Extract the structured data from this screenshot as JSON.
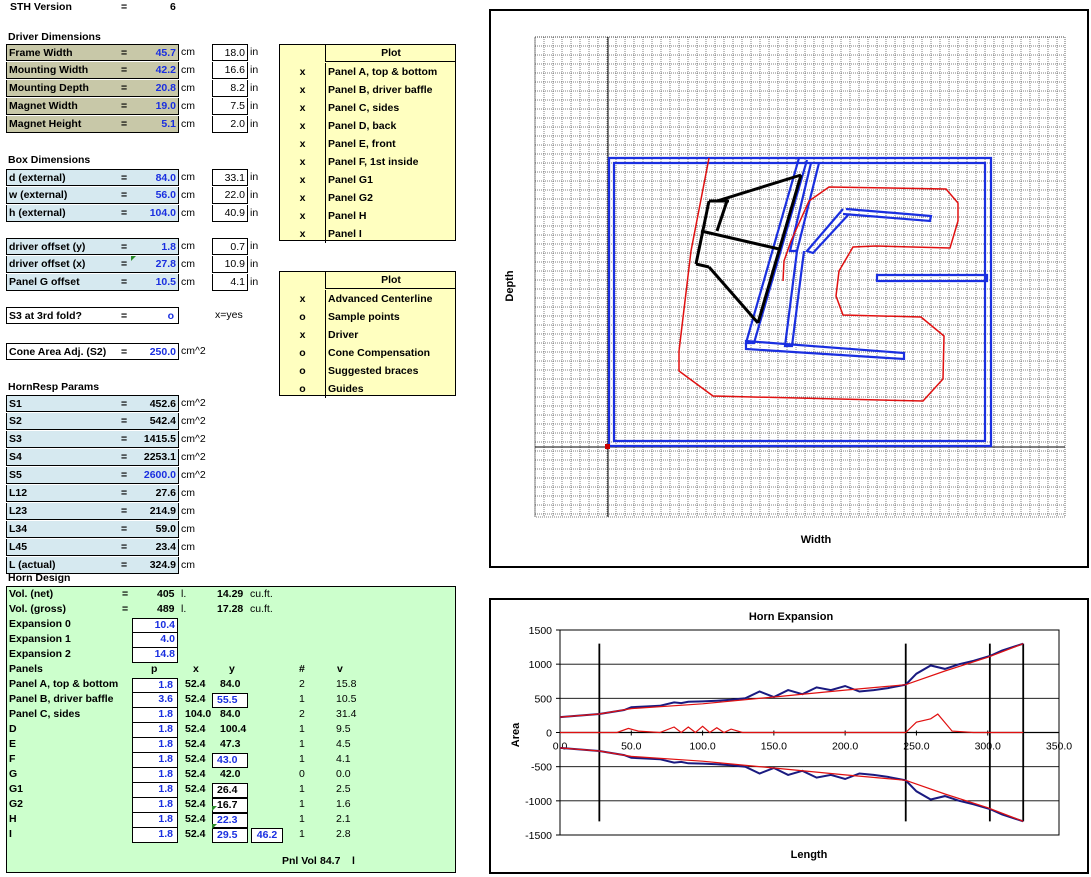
{
  "sth": {
    "label": "STH Version",
    "eq": "=",
    "value": "6"
  },
  "driver": {
    "title": "Driver Dimensions",
    "rows": [
      {
        "label": "Frame Width",
        "eq": "=",
        "cm": "45.7",
        "unit": "cm",
        "in": "18.0",
        "unit2": "in"
      },
      {
        "label": "Mounting Width",
        "eq": "=",
        "cm": "42.2",
        "unit": "cm",
        "in": "16.6",
        "unit2": "in"
      },
      {
        "label": "Mounting Depth",
        "eq": "=",
        "cm": "20.8",
        "unit": "cm",
        "in": "8.2",
        "unit2": "in"
      },
      {
        "label": "Magnet Width",
        "eq": "=",
        "cm": "19.0",
        "unit": "cm",
        "in": "7.5",
        "unit2": "in"
      },
      {
        "label": "Magnet Height",
        "eq": "=",
        "cm": "5.1",
        "unit": "cm",
        "in": "2.0",
        "unit2": "in"
      }
    ]
  },
  "box": {
    "title": "Box Dimensions",
    "rows": [
      {
        "label": "d (external)",
        "eq": "=",
        "cm": "84.0",
        "unit": "cm",
        "in": "33.1",
        "unit2": "in"
      },
      {
        "label": "w (external)",
        "eq": "=",
        "cm": "56.0",
        "unit": "cm",
        "in": "22.0",
        "unit2": "in"
      },
      {
        "label": "h (external)",
        "eq": "=",
        "cm": "104.0",
        "unit": "cm",
        "in": "40.9",
        "unit2": "in"
      }
    ]
  },
  "offsets": [
    {
      "label": "driver offset (y)",
      "eq": "=",
      "cm": "1.8",
      "unit": "cm",
      "in": "0.7",
      "unit2": "in"
    },
    {
      "label": "driver offset (x)",
      "eq": "=",
      "cm": "27.8",
      "unit": "cm",
      "in": "10.9",
      "unit2": "in"
    },
    {
      "label": "Panel G offset",
      "eq": "=",
      "cm": "10.5",
      "unit": "cm",
      "in": "4.1",
      "unit2": "in"
    }
  ],
  "s3fold": {
    "label": "S3 at 3rd fold?",
    "eq": "=",
    "value": "o",
    "hint": "x=yes"
  },
  "cone": {
    "label": "Cone Area Adj. (S2)",
    "eq": "=",
    "value": "250.0",
    "unit": "cm^2"
  },
  "plot1": {
    "header": "Plot",
    "items": [
      {
        "mark": "x",
        "label": "Panel A, top & bottom"
      },
      {
        "mark": "x",
        "label": "Panel B, driver baffle"
      },
      {
        "mark": "x",
        "label": "Panel C, sides"
      },
      {
        "mark": "x",
        "label": "Panel D, back"
      },
      {
        "mark": "x",
        "label": "Panel E, front"
      },
      {
        "mark": "x",
        "label": "Panel F, 1st inside"
      },
      {
        "mark": "x",
        "label": "Panel G1"
      },
      {
        "mark": "x",
        "label": "Panel G2"
      },
      {
        "mark": "x",
        "label": "Panel H"
      },
      {
        "mark": "x",
        "label": "Panel I"
      }
    ]
  },
  "plot2": {
    "header": "Plot",
    "items": [
      {
        "mark": "x",
        "label": "Advanced Centerline"
      },
      {
        "mark": "o",
        "label": "Sample points"
      },
      {
        "mark": "x",
        "label": "Driver"
      },
      {
        "mark": "o",
        "label": "Cone Compensation"
      },
      {
        "mark": "o",
        "label": "Suggested braces"
      },
      {
        "mark": "o",
        "label": "Guides"
      }
    ]
  },
  "hornresp": {
    "title": "HornResp Params",
    "rows": [
      {
        "label": "S1",
        "eq": "=",
        "value": "452.6",
        "unit": "cm^2"
      },
      {
        "label": "S2",
        "eq": "=",
        "value": "542.4",
        "unit": "cm^2"
      },
      {
        "label": "S3",
        "eq": "=",
        "value": "1415.5",
        "unit": "cm^2"
      },
      {
        "label": "S4",
        "eq": "=",
        "value": "2253.1",
        "unit": "cm^2"
      },
      {
        "label": "S5",
        "eq": "=",
        "value": "2600.0",
        "unit": "cm^2"
      },
      {
        "label": "L12",
        "eq": "=",
        "value": "27.6",
        "unit": "cm"
      },
      {
        "label": "L23",
        "eq": "=",
        "value": "214.9",
        "unit": "cm"
      },
      {
        "label": "L34",
        "eq": "=",
        "value": "59.0",
        "unit": "cm"
      },
      {
        "label": "L45",
        "eq": "=",
        "value": "23.4",
        "unit": "cm"
      },
      {
        "label": "L (actual)",
        "eq": "=",
        "value": "324.9",
        "unit": "cm"
      }
    ]
  },
  "horn": {
    "title": "Horn Design",
    "vol_net": {
      "label": "Vol. (net)",
      "eq": "=",
      "value": "405",
      "unit": "l.",
      "cuft": "14.29",
      "unit2": "cu.ft."
    },
    "vol_gross": {
      "label": "Vol. (gross)",
      "eq": "=",
      "value": "489",
      "unit": "l.",
      "cuft": "17.28",
      "unit2": "cu.ft."
    },
    "expansions": [
      {
        "label": "Expansion 0",
        "value": "10.4"
      },
      {
        "label": "Expansion 1",
        "value": "4.0"
      },
      {
        "label": "Expansion 2",
        "value": "14.8"
      }
    ],
    "headers": {
      "panels": "Panels",
      "p": "p",
      "x": "x",
      "y": "y",
      "n": "#",
      "v": "v"
    },
    "panels": [
      {
        "name": "Panel A, top & bottom",
        "p": "1.8",
        "x": "52.4",
        "y": "84.0",
        "y2": "",
        "n": "2",
        "v": "15.8"
      },
      {
        "name": "Panel B, driver baffle",
        "p": "3.6",
        "x": "52.4",
        "y": "55.5",
        "y2": "",
        "n": "1",
        "v": "10.5"
      },
      {
        "name": "Panel C, sides",
        "p": "1.8",
        "x": "104.0",
        "y": "84.0",
        "y2": "",
        "n": "2",
        "v": "31.4"
      },
      {
        "name": "D",
        "p": "1.8",
        "x": "52.4",
        "y": "100.4",
        "y2": "",
        "n": "1",
        "v": "9.5"
      },
      {
        "name": "E",
        "p": "1.8",
        "x": "52.4",
        "y": "47.3",
        "y2": "",
        "n": "1",
        "v": "4.5"
      },
      {
        "name": "F",
        "p": "1.8",
        "x": "52.4",
        "y": "43.0",
        "y2": "",
        "n": "1",
        "v": "4.1"
      },
      {
        "name": "G",
        "p": "1.8",
        "x": "52.4",
        "y": "42.0",
        "y2": "",
        "n": "0",
        "v": "0.0"
      },
      {
        "name": "G1",
        "p": "1.8",
        "x": "52.4",
        "y": "26.4",
        "y2": "",
        "n": "1",
        "v": "2.5"
      },
      {
        "name": "G2",
        "p": "1.8",
        "x": "52.4",
        "y": "16.7",
        "y2": "",
        "n": "1",
        "v": "1.6"
      },
      {
        "name": "H",
        "p": "1.8",
        "x": "52.4",
        "y": "22.3",
        "y2": "",
        "n": "1",
        "v": "2.1"
      },
      {
        "name": "I",
        "p": "1.8",
        "x": "52.4",
        "y": "29.5",
        "y2": "46.2",
        "n": "1",
        "v": "2.8"
      }
    ],
    "pnlvol": {
      "label": "Pnl Vol",
      "value": "84.7",
      "unit": "l"
    }
  },
  "chart_data": [
    {
      "type": "scatter",
      "title": "",
      "xlabel": "Width",
      "ylabel": "Depth",
      "grid": true,
      "colors": {
        "panels": "#1a2fe0",
        "centerline": "#e01010",
        "driver": "#000000"
      }
    },
    {
      "type": "line",
      "title": "Horn Expansion",
      "xlabel": "Length",
      "ylabel": "Area",
      "xlim": [
        0,
        350
      ],
      "ylim": [
        -1500,
        1500
      ],
      "xticks": [
        "0.0",
        "50.0",
        "100.0",
        "150.0",
        "200.0",
        "250.0",
        "300.0",
        "350.0"
      ],
      "yticks": [
        "1500",
        "1000",
        "500",
        "0",
        "-500",
        "-1000",
        "-1500"
      ],
      "vlines": [
        27.6,
        242.5,
        301.5,
        324.9
      ],
      "series": [
        {
          "color": "#1a1a80",
          "x": [
            0,
            27.6,
            45,
            50,
            60,
            70,
            80,
            85,
            90,
            100,
            110,
            120,
            130,
            140,
            150,
            160,
            170,
            180,
            190,
            200,
            210,
            220,
            230,
            242.5,
            250,
            260,
            270,
            280,
            290,
            301.5,
            310,
            324.9
          ],
          "y": [
            226,
            271,
            330,
            370,
            380,
            390,
            440,
            430,
            450,
            455,
            465,
            480,
            500,
            600,
            520,
            620,
            560,
            660,
            620,
            680,
            600,
            620,
            650,
            700,
            860,
            980,
            930,
            1000,
            1050,
            1120,
            1200,
            1300
          ]
        },
        {
          "color": "#e01010",
          "x": [
            0,
            27.6,
            50,
            100,
            150,
            200,
            242.5,
            270,
            300,
            324.9
          ],
          "y": [
            226,
            271,
            350,
            420,
            520,
            620,
            700,
            900,
            1100,
            1300
          ]
        },
        {
          "color": "#1a1a80",
          "x": [
            0,
            27.6,
            45,
            50,
            60,
            70,
            80,
            85,
            90,
            100,
            110,
            120,
            130,
            140,
            150,
            160,
            170,
            180,
            190,
            200,
            210,
            220,
            230,
            242.5,
            250,
            260,
            270,
            280,
            290,
            301.5,
            310,
            324.9
          ],
          "y": [
            -226,
            -271,
            -330,
            -370,
            -380,
            -390,
            -440,
            -430,
            -450,
            -455,
            -465,
            -480,
            -500,
            -600,
            -520,
            -620,
            -560,
            -660,
            -620,
            -680,
            -600,
            -620,
            -650,
            -700,
            -860,
            -980,
            -930,
            -1000,
            -1050,
            -1120,
            -1200,
            -1300
          ]
        },
        {
          "color": "#e01010",
          "x": [
            0,
            27.6,
            50,
            100,
            150,
            200,
            242.5,
            270,
            300,
            324.9
          ],
          "y": [
            -226,
            -271,
            -350,
            -420,
            -520,
            -620,
            -700,
            -900,
            -1100,
            -1300
          ]
        },
        {
          "color": "#e01010",
          "x": [
            0,
            27.6,
            40,
            48,
            55,
            70,
            80,
            85,
            90,
            95,
            100,
            105,
            110,
            115,
            120,
            128,
            135,
            145,
            150,
            155,
            160,
            165,
            172,
            180,
            190,
            200,
            210,
            230,
            242.5,
            250,
            260,
            265,
            275,
            290,
            324.9
          ],
          "y": [
            0,
            0,
            0,
            60,
            20,
            0,
            80,
            0,
            80,
            0,
            90,
            0,
            70,
            0,
            50,
            0,
            0,
            0,
            0,
            0,
            0,
            0,
            0,
            0,
            0,
            0,
            0,
            0,
            0,
            150,
            200,
            270,
            20,
            0,
            0
          ]
        }
      ]
    }
  ]
}
